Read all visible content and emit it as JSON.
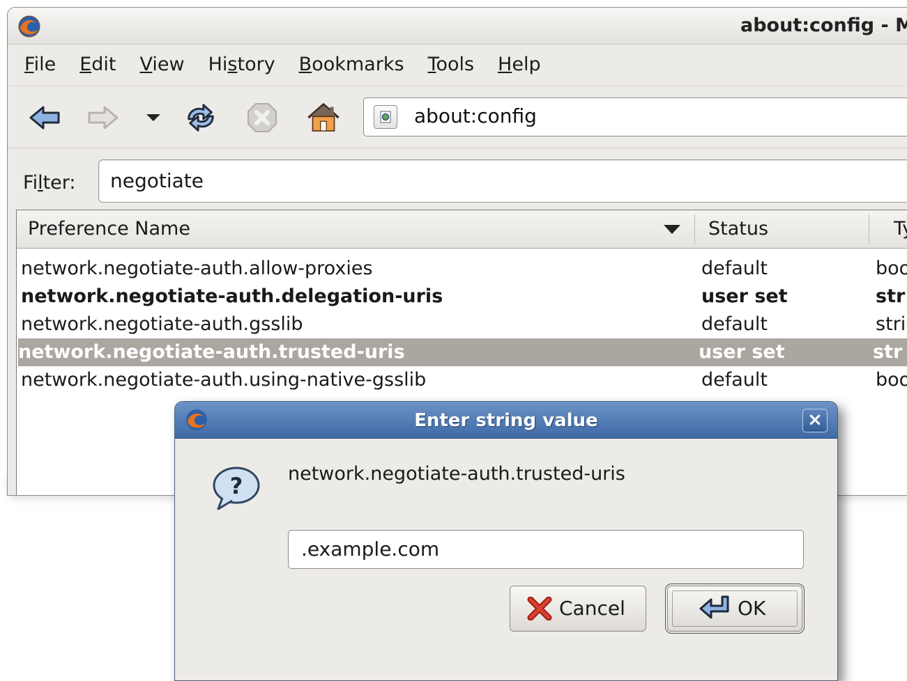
{
  "window": {
    "title": "about:config - M"
  },
  "menubar": {
    "items": [
      {
        "label_pre": "",
        "label_ul": "F",
        "label_post": "ile"
      },
      {
        "label_pre": "",
        "label_ul": "E",
        "label_post": "dit"
      },
      {
        "label_pre": "",
        "label_ul": "V",
        "label_post": "iew"
      },
      {
        "label_pre": "Hi",
        "label_ul": "s",
        "label_post": "tory"
      },
      {
        "label_pre": "",
        "label_ul": "B",
        "label_post": "ookmarks"
      },
      {
        "label_pre": "",
        "label_ul": "T",
        "label_post": "ools"
      },
      {
        "label_pre": "",
        "label_ul": "H",
        "label_post": "elp"
      }
    ]
  },
  "toolbar": {
    "icons": [
      "back-arrow-icon",
      "forward-arrow-icon",
      "dropdown-arrow-icon",
      "reload-icon",
      "stop-icon",
      "home-icon"
    ],
    "url": "about:config"
  },
  "filter": {
    "label_pre": "Fi",
    "label_ul": "l",
    "label_post": "ter:",
    "value": "negotiate"
  },
  "table": {
    "columns": [
      "Preference Name",
      "Status",
      "Ty"
    ],
    "rows": [
      {
        "name": "network.negotiate-auth.allow-proxies",
        "status": "default",
        "type": "boo",
        "bold": false,
        "selected": false
      },
      {
        "name": "network.negotiate-auth.delegation-uris",
        "status": "user set",
        "type": "str",
        "bold": true,
        "selected": false
      },
      {
        "name": "network.negotiate-auth.gsslib",
        "status": "default",
        "type": "stri",
        "bold": false,
        "selected": false
      },
      {
        "name": "network.negotiate-auth.trusted-uris",
        "status": "user set",
        "type": "str",
        "bold": true,
        "selected": true
      },
      {
        "name": "network.negotiate-auth.using-native-gsslib",
        "status": "default",
        "type": "boo",
        "bold": false,
        "selected": false
      }
    ]
  },
  "dialog": {
    "title": "Enter string value",
    "close": "×",
    "prompt": "network.negotiate-auth.trusted-uris",
    "value": ".example.com",
    "cancel_label": "Cancel",
    "ok_label": "OK",
    "colors": {
      "titlebar": "#4a74ad",
      "selection": "#aba69f"
    }
  }
}
